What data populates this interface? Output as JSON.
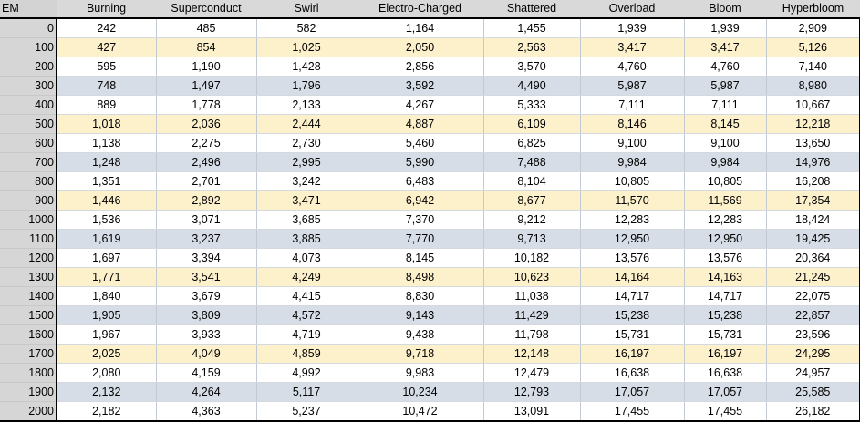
{
  "headers": [
    "EM",
    "Burning",
    "Superconduct",
    "Swirl",
    "Electro-Charged",
    "Shattered",
    "Overload",
    "Bloom",
    "Hyperbloom"
  ],
  "rows": [
    {
      "em": "0",
      "values": [
        "242",
        "485",
        "582",
        "1,164",
        "1,455",
        "1,939",
        "1,939",
        "2,909"
      ],
      "shade": "white"
    },
    {
      "em": "100",
      "values": [
        "427",
        "854",
        "1,025",
        "2,050",
        "2,563",
        "3,417",
        "3,417",
        "5,126"
      ],
      "shade": "yellow"
    },
    {
      "em": "200",
      "values": [
        "595",
        "1,190",
        "1,428",
        "2,856",
        "3,570",
        "4,760",
        "4,760",
        "7,140"
      ],
      "shade": "white"
    },
    {
      "em": "300",
      "values": [
        "748",
        "1,497",
        "1,796",
        "3,592",
        "4,490",
        "5,987",
        "5,987",
        "8,980"
      ],
      "shade": "blue"
    },
    {
      "em": "400",
      "values": [
        "889",
        "1,778",
        "2,133",
        "4,267",
        "5,333",
        "7,111",
        "7,111",
        "10,667"
      ],
      "shade": "white"
    },
    {
      "em": "500",
      "values": [
        "1,018",
        "2,036",
        "2,444",
        "4,887",
        "6,109",
        "8,146",
        "8,145",
        "12,218"
      ],
      "shade": "yellow"
    },
    {
      "em": "600",
      "values": [
        "1,138",
        "2,275",
        "2,730",
        "5,460",
        "6,825",
        "9,100",
        "9,100",
        "13,650"
      ],
      "shade": "white"
    },
    {
      "em": "700",
      "values": [
        "1,248",
        "2,496",
        "2,995",
        "5,990",
        "7,488",
        "9,984",
        "9,984",
        "14,976"
      ],
      "shade": "blue"
    },
    {
      "em": "800",
      "values": [
        "1,351",
        "2,701",
        "3,242",
        "6,483",
        "8,104",
        "10,805",
        "10,805",
        "16,208"
      ],
      "shade": "white"
    },
    {
      "em": "900",
      "values": [
        "1,446",
        "2,892",
        "3,471",
        "6,942",
        "8,677",
        "11,570",
        "11,569",
        "17,354"
      ],
      "shade": "yellow"
    },
    {
      "em": "1000",
      "values": [
        "1,536",
        "3,071",
        "3,685",
        "7,370",
        "9,212",
        "12,283",
        "12,283",
        "18,424"
      ],
      "shade": "white"
    },
    {
      "em": "1100",
      "values": [
        "1,619",
        "3,237",
        "3,885",
        "7,770",
        "9,713",
        "12,950",
        "12,950",
        "19,425"
      ],
      "shade": "blue"
    },
    {
      "em": "1200",
      "values": [
        "1,697",
        "3,394",
        "4,073",
        "8,145",
        "10,182",
        "13,576",
        "13,576",
        "20,364"
      ],
      "shade": "white"
    },
    {
      "em": "1300",
      "values": [
        "1,771",
        "3,541",
        "4,249",
        "8,498",
        "10,623",
        "14,164",
        "14,163",
        "21,245"
      ],
      "shade": "yellow"
    },
    {
      "em": "1400",
      "values": [
        "1,840",
        "3,679",
        "4,415",
        "8,830",
        "11,038",
        "14,717",
        "14,717",
        "22,075"
      ],
      "shade": "white"
    },
    {
      "em": "1500",
      "values": [
        "1,905",
        "3,809",
        "4,572",
        "9,143",
        "11,429",
        "15,238",
        "15,238",
        "22,857"
      ],
      "shade": "blue"
    },
    {
      "em": "1600",
      "values": [
        "1,967",
        "3,933",
        "4,719",
        "9,438",
        "11,798",
        "15,731",
        "15,731",
        "23,596"
      ],
      "shade": "white"
    },
    {
      "em": "1700",
      "values": [
        "2,025",
        "4,049",
        "4,859",
        "9,718",
        "12,148",
        "16,197",
        "16,197",
        "24,295"
      ],
      "shade": "yellow"
    },
    {
      "em": "1800",
      "values": [
        "2,080",
        "4,159",
        "4,992",
        "9,983",
        "12,479",
        "16,638",
        "16,638",
        "24,957"
      ],
      "shade": "white"
    },
    {
      "em": "1900",
      "values": [
        "2,132",
        "4,264",
        "5,117",
        "10,234",
        "12,793",
        "17,057",
        "17,057",
        "25,585"
      ],
      "shade": "blue"
    },
    {
      "em": "2000",
      "values": [
        "2,182",
        "4,363",
        "5,237",
        "10,472",
        "13,091",
        "17,455",
        "17,455",
        "26,182"
      ],
      "shade": "white"
    }
  ]
}
